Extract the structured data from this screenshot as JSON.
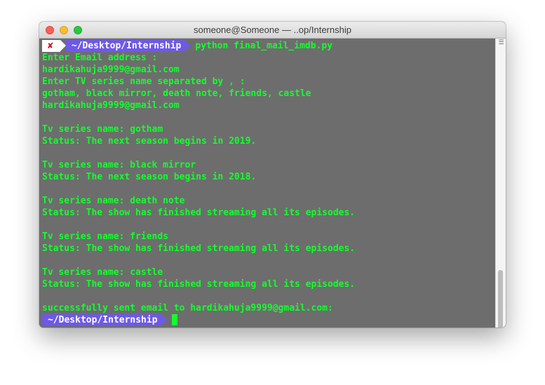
{
  "window": {
    "title": "someone@Someone — ..op/Internship"
  },
  "prompt": {
    "status_icon": "✘",
    "directory": "~/Desktop/Internship",
    "command": "python final_mail_imdb.py"
  },
  "output_lines": [
    "Enter Email address :",
    "hardikahuja9999@gmail.com",
    "Enter TV series name separated by , :",
    "gotham, black mirror, death note, friends, castle",
    "hardikahuja9999@gmail.com",
    "",
    "Tv series name: gotham",
    "Status: The next season begins in 2019.",
    "",
    "Tv series name: black mirror",
    "Status: The next season begins in 2018.",
    "",
    "Tv series name: death note",
    "Status: The show has finished streaming all its episodes.",
    "",
    "Tv series name: friends",
    "Status: The show has finished streaming all its episodes.",
    "",
    "Tv series name: castle",
    "Status: The show has finished streaming all its episodes.",
    "",
    "successfully sent email to hardikahuja9999@gmail.com:"
  ],
  "colors": {
    "terminal_bg": "#6d6d6d",
    "text_green": "#13ff2d",
    "prompt_purple": "#6e59e6",
    "error_red": "#d0021b"
  },
  "icons": {
    "status": "error-x-icon",
    "scroll_menu": "scroll-menu-icon"
  }
}
